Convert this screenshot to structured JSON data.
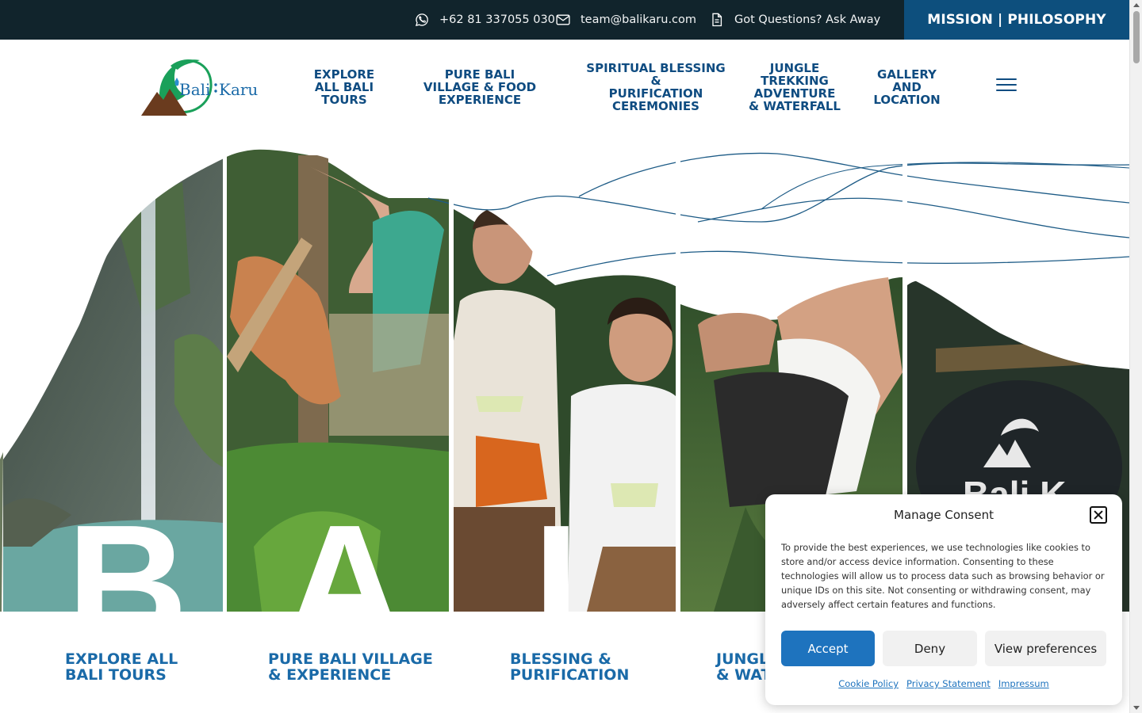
{
  "topbar": {
    "phone": "+62 81 337055 030",
    "email": "team@balikaru.com",
    "questions": "Got Questions? Ask Away",
    "mission": "MISSION | PHILOSOPHY"
  },
  "logo": {
    "text_left": "Bali",
    "text_right": "Karu"
  },
  "nav": {
    "items": [
      {
        "lines": [
          "EXPLORE",
          "ALL BALI",
          "TOURS"
        ]
      },
      {
        "lines": [
          "PURE BALI",
          "VILLAGE & FOOD",
          "EXPERIENCE"
        ]
      },
      {
        "lines": [
          "SPIRITUAL BLESSING &",
          "PURIFICATION",
          "CEREMONIES"
        ]
      },
      {
        "lines": [
          "JUNGLE TREKKING",
          "ADVENTURE",
          "& WATERFALL"
        ]
      },
      {
        "lines": [
          "GALLERY AND",
          "LOCATION"
        ]
      }
    ]
  },
  "hero": {
    "letters": [
      "B",
      "A",
      "L"
    ],
    "logo_word": "Bali K"
  },
  "categories": [
    {
      "lines": [
        "EXPLORE ALL",
        "BALI TOURS"
      ]
    },
    {
      "lines": [
        "PURE BALI VILLAGE",
        "& EXPERIENCE"
      ]
    },
    {
      "lines": [
        "BLESSING &",
        "PURIFICATION"
      ]
    },
    {
      "lines": [
        "JUNGL",
        "& WAT"
      ]
    }
  ],
  "consent": {
    "title": "Manage Consent",
    "message": "To provide the best experiences, we use technologies like cookies to store and/or access device information. Consenting to these technologies will allow us to process data such as browsing behavior or unique IDs on this site. Not consenting or withdrawing consent, may adversely affect certain features and functions.",
    "accept": "Accept",
    "deny": "Deny",
    "preferences": "View preferences",
    "links": [
      "Cookie Policy",
      "Privacy Statement",
      "Impressum"
    ]
  },
  "colors": {
    "topbar_bg": "#11242c",
    "mission_bg": "#0d4f7d",
    "nav_text": "#0f4c81",
    "category_text": "#1a6aa8",
    "accept_bg": "#1e73be"
  }
}
